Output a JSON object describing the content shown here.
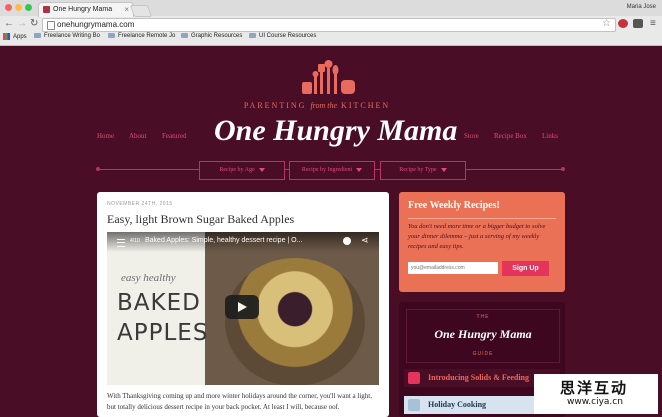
{
  "browser": {
    "tab_title": "One Hungry Mama",
    "url": "onehungrymama.com",
    "user": "Maria Jose",
    "bookmarks": [
      "Apps",
      "Freelance Writing Bo",
      "Freelance Remote Jo",
      "Graphic Resources",
      "UI Course Resources"
    ]
  },
  "site": {
    "tagline_a": "PARENTING",
    "tagline_b": "from the",
    "tagline_c": "KITCHEN",
    "title": "One Hungry Mama",
    "nav_left": [
      "Home",
      "About",
      "Featured"
    ],
    "nav_right": [
      "Store",
      "Recipe Box",
      "Links"
    ],
    "dropdowns": [
      "Recipe by Age",
      "Recipe by Ingredient",
      "Recipe by Type"
    ]
  },
  "post": {
    "date": "NOVEMBER 24TH, 2015",
    "title": "Easy, light Brown Sugar Baked Apples",
    "video": {
      "counter": "4/10",
      "title": "Baked Apples: Simple, healthy dessert recipe | O...",
      "overlay_small": "easy healthy",
      "overlay_big_1": "BAKED",
      "overlay_big_2": "APPLES"
    },
    "excerpt": "With Thanksgiving coming up and more winter holidays around the corner, you'll want a light, but totally delicious dessert recipe in your back pocket. At least I will, because oof."
  },
  "newsletter": {
    "title": "Free Weekly Recipes!",
    "body": "You don't need more time or a bigger budget to solve your dinner dilemma – just a serving of my weekly recipes and easy tips.",
    "placeholder": "you@emailaddress.com",
    "button": "Sign Up"
  },
  "guide": {
    "the": "THE",
    "title": "One Hungry Mama",
    "guide": "GUIDE",
    "items": [
      "Introducing Solids & Feeding",
      "Holiday Cooking"
    ]
  },
  "watermark": {
    "chinese": "思洋互动",
    "url": "www.ciya.cn"
  },
  "colors": {
    "accent_coral": "#ea7155",
    "accent_pink": "#e4497a",
    "background": "#4a0d26",
    "button": "#e4345c"
  }
}
